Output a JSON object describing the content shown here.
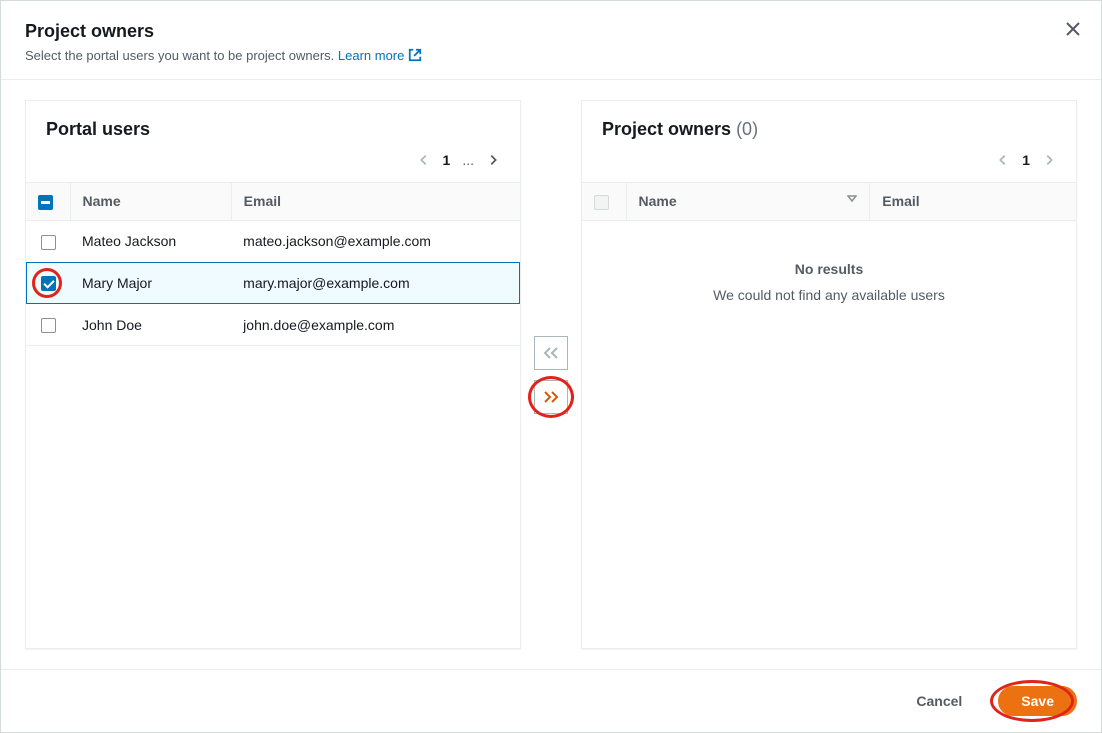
{
  "header": {
    "title": "Project owners",
    "subtitle": "Select the portal users you want to be project owners. ",
    "learn_more": "Learn more"
  },
  "left_panel": {
    "title": "Portal users",
    "columns": {
      "name": "Name",
      "email": "Email"
    },
    "pagination": {
      "current": "1",
      "ellipsis": "..."
    },
    "rows": [
      {
        "name": "Mateo Jackson",
        "email": "mateo.jackson@example.com",
        "checked": false
      },
      {
        "name": "Mary Major",
        "email": "mary.major@example.com",
        "checked": true
      },
      {
        "name": "John Doe",
        "email": "john.doe@example.com",
        "checked": false
      }
    ]
  },
  "right_panel": {
    "title": "Project owners",
    "count": "(0)",
    "columns": {
      "name": "Name",
      "email": "Email"
    },
    "pagination": {
      "current": "1"
    },
    "empty_title": "No results",
    "empty_sub": "We could not find any available users"
  },
  "footer": {
    "cancel": "Cancel",
    "save": "Save"
  }
}
